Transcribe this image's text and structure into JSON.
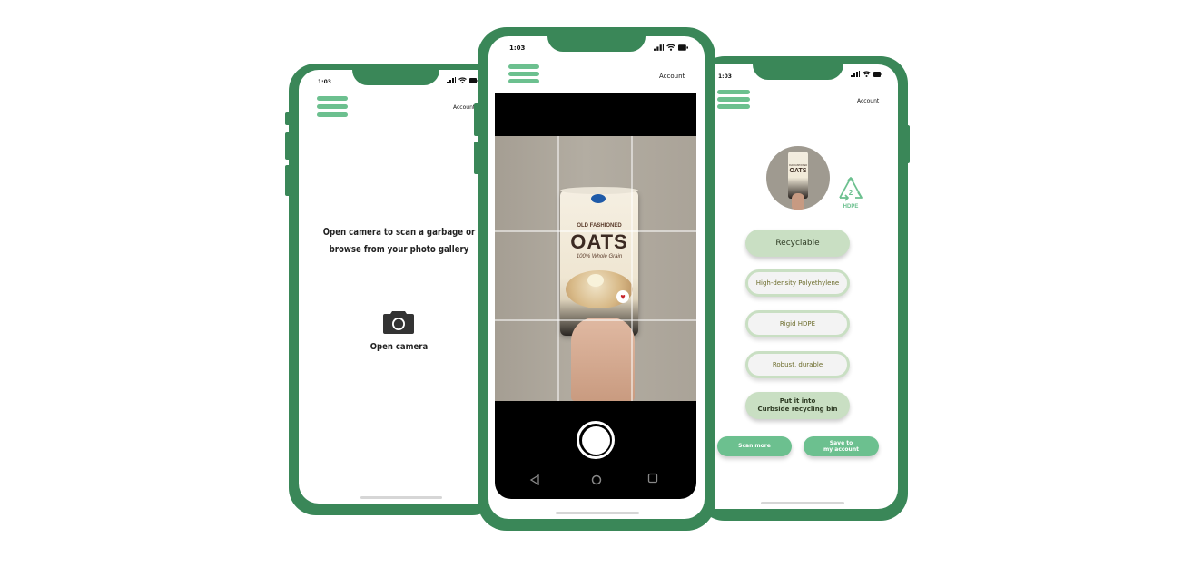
{
  "left_screen": {
    "time": "1:03",
    "account_label": "Account",
    "instruction_line1": "Open camera to scan a garbage or",
    "instruction_line2": "browse from your photo gallery",
    "camera_button_label": "Open camera",
    "camera_icon": "camera-icon"
  },
  "center_screen": {
    "time": "1:03",
    "account_label": "Account",
    "product_brand": "OLD FASHIONED",
    "product_name": "OATS",
    "product_sub": "100% Whole Grain",
    "nav_icons": [
      "back-triangle-icon",
      "home-circle-icon",
      "recents-square-icon"
    ]
  },
  "right_screen": {
    "time": "1:03",
    "account_label": "Account",
    "thumb_brand": "OLD FASHIONED",
    "thumb_name": "OATS",
    "recycle_number": "2",
    "recycle_code": "HDPE",
    "recyclable_label": "Recyclable",
    "material_label": "High-density Polyethylene",
    "type_label": "Rigid HDPE",
    "property_label": "Robust, durable",
    "disposal_line1": "Put it into",
    "disposal_line2": "Curbside recycling bin",
    "scan_more_label": "Scan more",
    "save_line1": "Save to",
    "save_line2": "my account"
  },
  "colors": {
    "phone_frame": "#3a8758",
    "accent_green": "#6cc08f",
    "pill_green": "#c9dfc3",
    "recycle_icon": "#6cc08f"
  }
}
